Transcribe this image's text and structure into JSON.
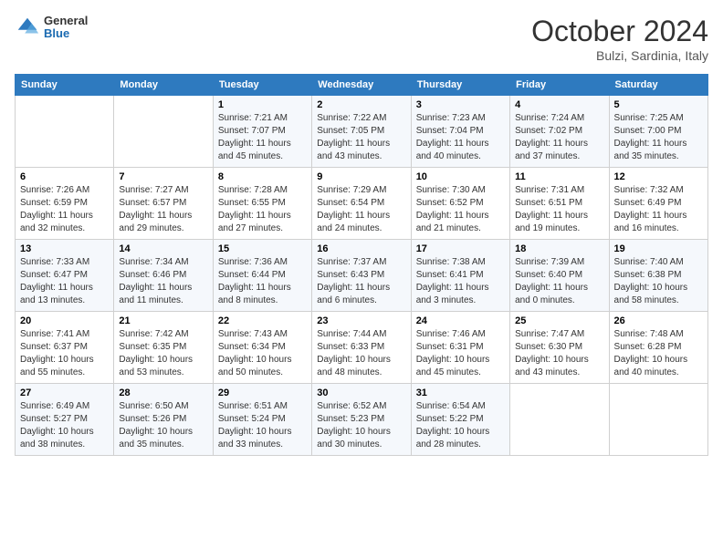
{
  "header": {
    "logo_general": "General",
    "logo_blue": "Blue",
    "month_title": "October 2024",
    "subtitle": "Bulzi, Sardinia, Italy"
  },
  "weekdays": [
    "Sunday",
    "Monday",
    "Tuesday",
    "Wednesday",
    "Thursday",
    "Friday",
    "Saturday"
  ],
  "rows": [
    [
      {
        "day": "",
        "sunrise": "",
        "sunset": "",
        "daylight": ""
      },
      {
        "day": "",
        "sunrise": "",
        "sunset": "",
        "daylight": ""
      },
      {
        "day": "1",
        "sunrise": "Sunrise: 7:21 AM",
        "sunset": "Sunset: 7:07 PM",
        "daylight": "Daylight: 11 hours and 45 minutes."
      },
      {
        "day": "2",
        "sunrise": "Sunrise: 7:22 AM",
        "sunset": "Sunset: 7:05 PM",
        "daylight": "Daylight: 11 hours and 43 minutes."
      },
      {
        "day": "3",
        "sunrise": "Sunrise: 7:23 AM",
        "sunset": "Sunset: 7:04 PM",
        "daylight": "Daylight: 11 hours and 40 minutes."
      },
      {
        "day": "4",
        "sunrise": "Sunrise: 7:24 AM",
        "sunset": "Sunset: 7:02 PM",
        "daylight": "Daylight: 11 hours and 37 minutes."
      },
      {
        "day": "5",
        "sunrise": "Sunrise: 7:25 AM",
        "sunset": "Sunset: 7:00 PM",
        "daylight": "Daylight: 11 hours and 35 minutes."
      }
    ],
    [
      {
        "day": "6",
        "sunrise": "Sunrise: 7:26 AM",
        "sunset": "Sunset: 6:59 PM",
        "daylight": "Daylight: 11 hours and 32 minutes."
      },
      {
        "day": "7",
        "sunrise": "Sunrise: 7:27 AM",
        "sunset": "Sunset: 6:57 PM",
        "daylight": "Daylight: 11 hours and 29 minutes."
      },
      {
        "day": "8",
        "sunrise": "Sunrise: 7:28 AM",
        "sunset": "Sunset: 6:55 PM",
        "daylight": "Daylight: 11 hours and 27 minutes."
      },
      {
        "day": "9",
        "sunrise": "Sunrise: 7:29 AM",
        "sunset": "Sunset: 6:54 PM",
        "daylight": "Daylight: 11 hours and 24 minutes."
      },
      {
        "day": "10",
        "sunrise": "Sunrise: 7:30 AM",
        "sunset": "Sunset: 6:52 PM",
        "daylight": "Daylight: 11 hours and 21 minutes."
      },
      {
        "day": "11",
        "sunrise": "Sunrise: 7:31 AM",
        "sunset": "Sunset: 6:51 PM",
        "daylight": "Daylight: 11 hours and 19 minutes."
      },
      {
        "day": "12",
        "sunrise": "Sunrise: 7:32 AM",
        "sunset": "Sunset: 6:49 PM",
        "daylight": "Daylight: 11 hours and 16 minutes."
      }
    ],
    [
      {
        "day": "13",
        "sunrise": "Sunrise: 7:33 AM",
        "sunset": "Sunset: 6:47 PM",
        "daylight": "Daylight: 11 hours and 13 minutes."
      },
      {
        "day": "14",
        "sunrise": "Sunrise: 7:34 AM",
        "sunset": "Sunset: 6:46 PM",
        "daylight": "Daylight: 11 hours and 11 minutes."
      },
      {
        "day": "15",
        "sunrise": "Sunrise: 7:36 AM",
        "sunset": "Sunset: 6:44 PM",
        "daylight": "Daylight: 11 hours and 8 minutes."
      },
      {
        "day": "16",
        "sunrise": "Sunrise: 7:37 AM",
        "sunset": "Sunset: 6:43 PM",
        "daylight": "Daylight: 11 hours and 6 minutes."
      },
      {
        "day": "17",
        "sunrise": "Sunrise: 7:38 AM",
        "sunset": "Sunset: 6:41 PM",
        "daylight": "Daylight: 11 hours and 3 minutes."
      },
      {
        "day": "18",
        "sunrise": "Sunrise: 7:39 AM",
        "sunset": "Sunset: 6:40 PM",
        "daylight": "Daylight: 11 hours and 0 minutes."
      },
      {
        "day": "19",
        "sunrise": "Sunrise: 7:40 AM",
        "sunset": "Sunset: 6:38 PM",
        "daylight": "Daylight: 10 hours and 58 minutes."
      }
    ],
    [
      {
        "day": "20",
        "sunrise": "Sunrise: 7:41 AM",
        "sunset": "Sunset: 6:37 PM",
        "daylight": "Daylight: 10 hours and 55 minutes."
      },
      {
        "day": "21",
        "sunrise": "Sunrise: 7:42 AM",
        "sunset": "Sunset: 6:35 PM",
        "daylight": "Daylight: 10 hours and 53 minutes."
      },
      {
        "day": "22",
        "sunrise": "Sunrise: 7:43 AM",
        "sunset": "Sunset: 6:34 PM",
        "daylight": "Daylight: 10 hours and 50 minutes."
      },
      {
        "day": "23",
        "sunrise": "Sunrise: 7:44 AM",
        "sunset": "Sunset: 6:33 PM",
        "daylight": "Daylight: 10 hours and 48 minutes."
      },
      {
        "day": "24",
        "sunrise": "Sunrise: 7:46 AM",
        "sunset": "Sunset: 6:31 PM",
        "daylight": "Daylight: 10 hours and 45 minutes."
      },
      {
        "day": "25",
        "sunrise": "Sunrise: 7:47 AM",
        "sunset": "Sunset: 6:30 PM",
        "daylight": "Daylight: 10 hours and 43 minutes."
      },
      {
        "day": "26",
        "sunrise": "Sunrise: 7:48 AM",
        "sunset": "Sunset: 6:28 PM",
        "daylight": "Daylight: 10 hours and 40 minutes."
      }
    ],
    [
      {
        "day": "27",
        "sunrise": "Sunrise: 6:49 AM",
        "sunset": "Sunset: 5:27 PM",
        "daylight": "Daylight: 10 hours and 38 minutes."
      },
      {
        "day": "28",
        "sunrise": "Sunrise: 6:50 AM",
        "sunset": "Sunset: 5:26 PM",
        "daylight": "Daylight: 10 hours and 35 minutes."
      },
      {
        "day": "29",
        "sunrise": "Sunrise: 6:51 AM",
        "sunset": "Sunset: 5:24 PM",
        "daylight": "Daylight: 10 hours and 33 minutes."
      },
      {
        "day": "30",
        "sunrise": "Sunrise: 6:52 AM",
        "sunset": "Sunset: 5:23 PM",
        "daylight": "Daylight: 10 hours and 30 minutes."
      },
      {
        "day": "31",
        "sunrise": "Sunrise: 6:54 AM",
        "sunset": "Sunset: 5:22 PM",
        "daylight": "Daylight: 10 hours and 28 minutes."
      },
      {
        "day": "",
        "sunrise": "",
        "sunset": "",
        "daylight": ""
      },
      {
        "day": "",
        "sunrise": "",
        "sunset": "",
        "daylight": ""
      }
    ]
  ]
}
